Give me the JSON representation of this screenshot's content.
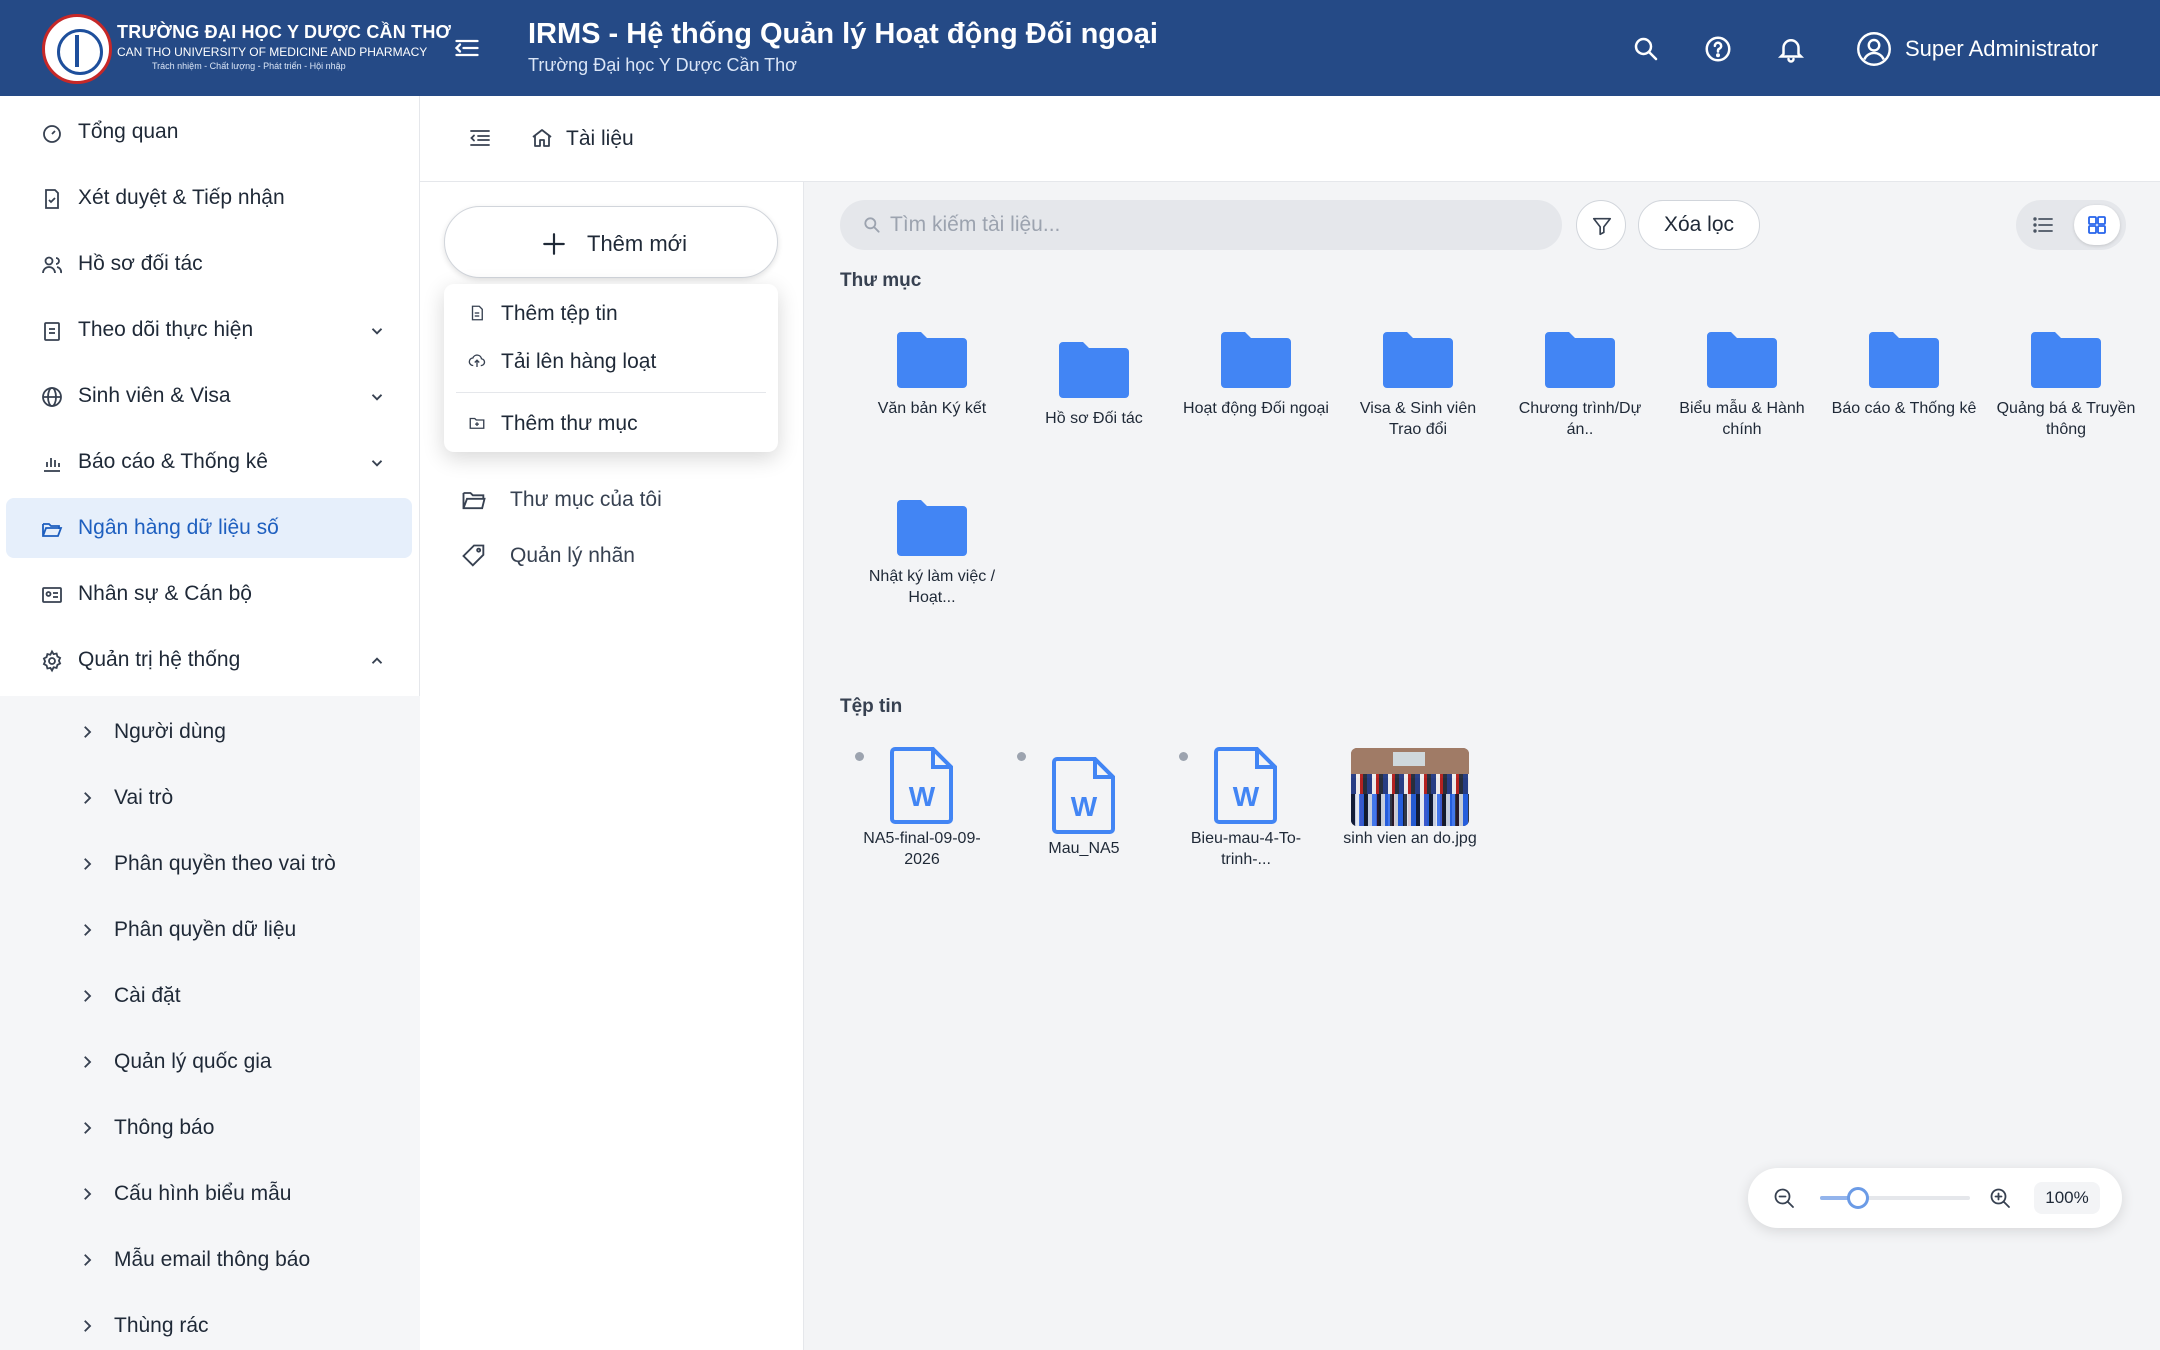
{
  "header": {
    "logo_line1": "TRƯỜNG ĐẠI HỌC Y DƯỢC CẦN THƠ",
    "logo_line2": "CAN THO UNIVERSITY OF MEDICINE AND PHARMACY",
    "logo_line3": "Trách nhiệm - Chất lượng - Phát triển - Hội nhập",
    "title": "IRMS - Hệ thống Quản lý Hoạt động Đối ngoại",
    "subtitle": "Trường Đại học Y Dược Cần Thơ",
    "user_name": "Super Administrator",
    "accent_color": "#254a86"
  },
  "sidebar": {
    "items": [
      {
        "label": "Tổng quan",
        "icon": "dashboard-icon"
      },
      {
        "label": "Xét duyệt & Tiếp nhận",
        "icon": "document-check-icon"
      },
      {
        "label": "Hồ sơ đối tác",
        "icon": "users-icon"
      },
      {
        "label": "Theo dõi thực hiện",
        "icon": "clipboard-icon",
        "expandable": true
      },
      {
        "label": "Sinh viên & Visa",
        "icon": "globe-icon",
        "expandable": true
      },
      {
        "label": "Báo cáo & Thống kê",
        "icon": "bar-chart-icon",
        "expandable": true
      },
      {
        "label": "Ngân hàng dữ liệu số",
        "icon": "folder-open-icon",
        "active": true
      },
      {
        "label": "Nhân sự & Cán bộ",
        "icon": "id-card-icon"
      },
      {
        "label": "Quản trị hệ thống",
        "icon": "gear-icon",
        "expanded": true
      }
    ],
    "sub_items": [
      {
        "label": "Người dùng"
      },
      {
        "label": "Vai trò"
      },
      {
        "label": "Phân quyền theo vai trò"
      },
      {
        "label": "Phân quyền dữ liệu"
      },
      {
        "label": "Cài đặt"
      },
      {
        "label": "Quản lý quốc gia"
      },
      {
        "label": "Thông báo"
      },
      {
        "label": "Cấu hình biểu mẫu"
      },
      {
        "label": "Mẫu email thông báo"
      },
      {
        "label": "Thùng rác"
      }
    ]
  },
  "breadcrumb": {
    "label": "Tài liệu"
  },
  "left_panel": {
    "add_label": "Thêm mới",
    "items": [
      {
        "label": "Thư mục của tôi",
        "icon": "folder-icon"
      },
      {
        "label": "Quản lý nhãn",
        "icon": "tag-icon"
      }
    ]
  },
  "dropdown": {
    "items": [
      {
        "label": "Thêm tệp tin",
        "icon": "file-icon"
      },
      {
        "label": "Tải lên hàng loạt",
        "icon": "cloud-upload-icon"
      },
      {
        "label": "Thêm thư mục",
        "icon": "folder-plus-icon"
      }
    ]
  },
  "toolbar": {
    "search_placeholder": "Tìm kiếm tài liệu...",
    "clear_filter_label": "Xóa lọc"
  },
  "folders_section": {
    "title": "Thư mục",
    "items": [
      {
        "label": "Văn bản Ký kết"
      },
      {
        "label": "Hồ sơ Đối tác"
      },
      {
        "label": "Hoạt động Đối ngoại"
      },
      {
        "label": "Visa & Sinh viên Trao đổi"
      },
      {
        "label": "Chương trình/Dự án.."
      },
      {
        "label": "Biểu mẫu & Hành chính"
      },
      {
        "label": "Báo cáo & Thống kê"
      },
      {
        "label": "Quảng bá & Truyền thông"
      },
      {
        "label": "Nhật ký làm việc / Hoạt..."
      }
    ]
  },
  "files_section": {
    "title": "Tệp tin",
    "items": [
      {
        "label": "NA5-final-09-09-2026",
        "type": "word"
      },
      {
        "label": "Mau_NA5",
        "type": "word"
      },
      {
        "label": "Bieu-mau-4-To-trinh-...",
        "type": "word"
      },
      {
        "label": "sinh vien an do.jpg",
        "type": "image"
      }
    ]
  },
  "zoom": {
    "label": "100%",
    "level": 0.25
  }
}
